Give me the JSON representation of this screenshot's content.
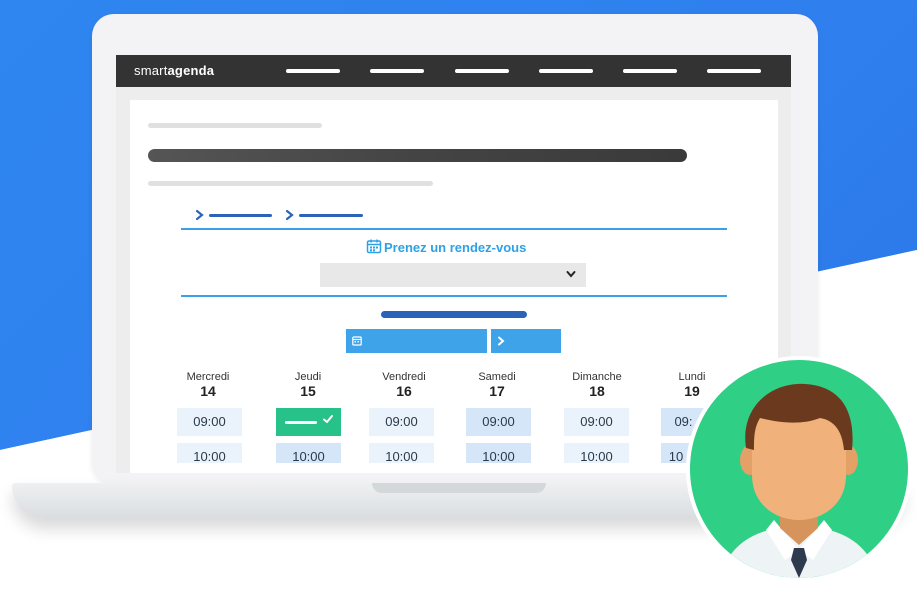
{
  "app": {
    "logo_prefix": "smart",
    "logo_suffix": "agenda"
  },
  "booking": {
    "title": "Prenez un rendez-vous",
    "select_value": ""
  },
  "days": [
    {
      "name": "Mercredi",
      "num": "14"
    },
    {
      "name": "Jeudi",
      "num": "15"
    },
    {
      "name": "Vendredi",
      "num": "16"
    },
    {
      "name": "Samedi",
      "num": "17"
    },
    {
      "name": "Dimanche",
      "num": "18"
    },
    {
      "name": "Lundi",
      "num": "19"
    }
  ],
  "slots": {
    "row1": [
      "09:00",
      "",
      "09:00",
      "09:00",
      "09:00",
      "09:"
    ],
    "row2": [
      "10:00",
      "10:00",
      "10:00",
      "10:00",
      "10:00",
      "10"
    ]
  },
  "icons": {
    "calendar": "calendar-icon",
    "chevron": "chevron-down-icon",
    "next": "chevron-right-icon",
    "check": "check-icon"
  },
  "colors": {
    "accent": "#2da1e6",
    "selected": "#27c28a",
    "dark_blue": "#2b63b8",
    "topbar": "#333333",
    "avatar_bg": "#2fcf86"
  }
}
